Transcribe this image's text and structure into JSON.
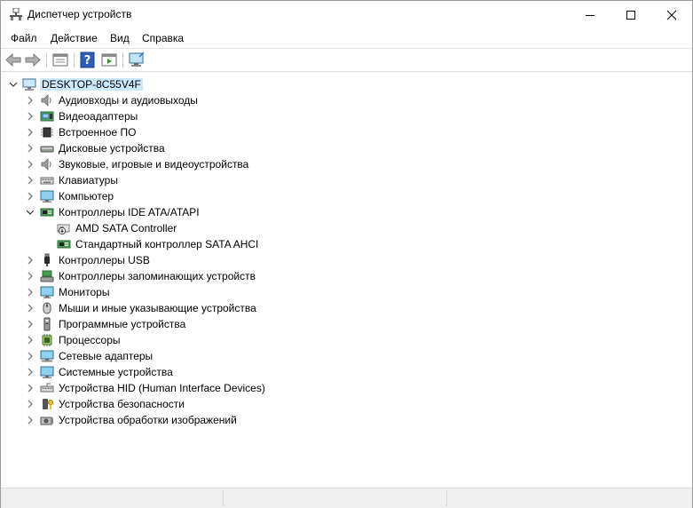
{
  "window": {
    "title": "Диспетчер устройств",
    "controls": [
      "minimize-icon",
      "maximize-icon",
      "close-icon"
    ]
  },
  "menu": [
    "Файл",
    "Действие",
    "Вид",
    "Справка"
  ],
  "toolbar": [
    "back-arrow-icon",
    "forward-arrow-icon",
    "properties-icon",
    "help-icon",
    "driver-icon",
    "monitor-scan-icon"
  ],
  "tree": {
    "root": "DESKTOP-8C55V4F",
    "categories": [
      {
        "label": "Аудиовходы и аудиовыходы",
        "icon": "speaker-icon"
      },
      {
        "label": "Видеоадаптеры",
        "icon": "display-adapter-icon"
      },
      {
        "label": "Встроенное ПО",
        "icon": "firmware-chip-icon"
      },
      {
        "label": "Дисковые устройства",
        "icon": "disk-drive-icon"
      },
      {
        "label": "Звуковые, игровые и видеоустройства",
        "icon": "speaker-icon"
      },
      {
        "label": "Клавиатуры",
        "icon": "keyboard-icon"
      },
      {
        "label": "Компьютер",
        "icon": "computer-icon"
      },
      {
        "label": "Контроллеры IDE ATA/ATAPI",
        "icon": "ide-controller-icon",
        "expanded": true,
        "children": [
          {
            "label": "AMD SATA Controller",
            "icon": "sata-controller-warning-icon"
          },
          {
            "label": "Стандартный контроллер SATA AHCI",
            "icon": "sata-controller-icon"
          }
        ]
      },
      {
        "label": "Контроллеры USB",
        "icon": "usb-icon"
      },
      {
        "label": "Контроллеры запоминающих устройств",
        "icon": "storage-controller-icon"
      },
      {
        "label": "Мониторы",
        "icon": "monitor-icon"
      },
      {
        "label": "Мыши и иные указывающие устройства",
        "icon": "mouse-icon"
      },
      {
        "label": "Программные устройства",
        "icon": "software-device-icon"
      },
      {
        "label": "Процессоры",
        "icon": "processor-icon"
      },
      {
        "label": "Сетевые адаптеры",
        "icon": "network-adapter-icon"
      },
      {
        "label": "Системные устройства",
        "icon": "system-device-icon"
      },
      {
        "label": "Устройства HID (Human Interface Devices)",
        "icon": "hid-icon"
      },
      {
        "label": "Устройства безопасности",
        "icon": "security-key-icon"
      },
      {
        "label": "Устройства обработки изображений",
        "icon": "camera-icon"
      }
    ]
  },
  "colors": {
    "selection": "#cce8ff",
    "accent": "#1e78c8"
  }
}
